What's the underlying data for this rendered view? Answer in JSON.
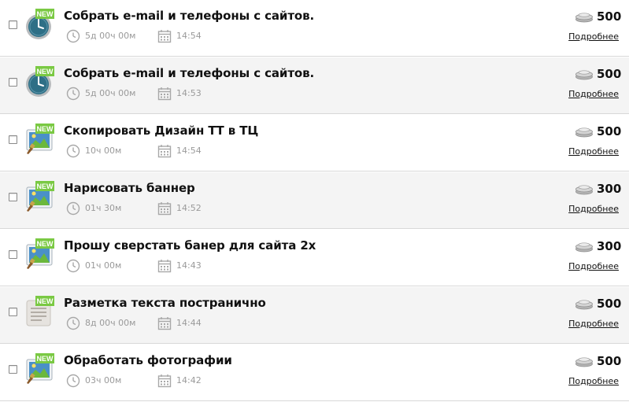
{
  "tasks": [
    {
      "category_icon": "clock-icon",
      "new_badge": "NEW",
      "title": "Собрать e-mail и телефоны с сайтов.",
      "duration": "5д 00ч 00м",
      "time": "14:54",
      "price": "500",
      "details_label": "Подробнее"
    },
    {
      "category_icon": "clock-icon",
      "new_badge": "NEW",
      "title": "Собрать e-mail и телефоны с сайтов.",
      "duration": "5д 00ч 00м",
      "time": "14:53",
      "price": "500",
      "details_label": "Подробнее"
    },
    {
      "category_icon": "picture-brush-icon",
      "new_badge": "NEW",
      "title": "Скопировать Дизайн ТТ в ТЦ",
      "duration": "10ч 00м",
      "time": "14:54",
      "price": "500",
      "details_label": "Подробнее"
    },
    {
      "category_icon": "picture-brush-icon",
      "new_badge": "NEW",
      "title": "Нарисовать баннер",
      "duration": "01ч 30м",
      "time": "14:52",
      "price": "300",
      "details_label": "Подробнее"
    },
    {
      "category_icon": "picture-brush-icon",
      "new_badge": "NEW",
      "title": "Прошу сверстать банер для сайта 2х",
      "duration": "01ч 00м",
      "time": "14:43",
      "price": "300",
      "details_label": "Подробнее"
    },
    {
      "category_icon": "document-icon",
      "new_badge": "NEW",
      "title": "Разметка текста постранично",
      "duration": "8д 00ч 00м",
      "time": "14:44",
      "price": "500",
      "details_label": "Подробнее"
    },
    {
      "category_icon": "picture-brush-icon",
      "new_badge": "NEW",
      "title": "Обработать фотографии",
      "duration": "03ч 00м",
      "time": "14:42",
      "price": "500",
      "details_label": "Подробнее"
    }
  ],
  "meta_icons": {
    "duration": "clock-outline-icon",
    "time": "calendar-icon"
  },
  "price_icon": "coin-stack-icon",
  "colors": {
    "row_alt_bg": "#f4f4f4",
    "new_badge": "#7ac943",
    "meta_text": "#9a9a9a",
    "clock_face": "#2e6f86",
    "picture_sky": "#4a90c8",
    "picture_grass": "#6bb83c"
  }
}
